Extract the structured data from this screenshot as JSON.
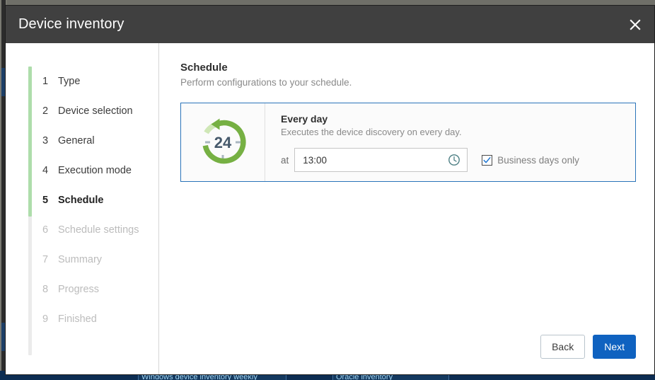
{
  "window": {
    "title": "Device inventory",
    "close_icon": "close-icon"
  },
  "sidebar": {
    "steps": [
      {
        "number": "1",
        "label": "Type",
        "state": "done"
      },
      {
        "number": "2",
        "label": "Device selection",
        "state": "done"
      },
      {
        "number": "3",
        "label": "General",
        "state": "done"
      },
      {
        "number": "4",
        "label": "Execution mode",
        "state": "done"
      },
      {
        "number": "5",
        "label": "Schedule",
        "state": "current"
      },
      {
        "number": "6",
        "label": "Schedule settings",
        "state": "future"
      },
      {
        "number": "7",
        "label": "Summary",
        "state": "future"
      },
      {
        "number": "8",
        "label": "Progress",
        "state": "future"
      },
      {
        "number": "9",
        "label": "Finished",
        "state": "future"
      }
    ]
  },
  "main": {
    "title": "Schedule",
    "subtitle": "Perform configurations to your schedule.",
    "card": {
      "icon_label": "24",
      "icon_name": "every-day-recurrence-icon",
      "title": "Every day",
      "description": "Executes the device discovery on every day.",
      "at_label": "at",
      "time_value": "13:00",
      "time_placeholder": "hh:mm",
      "clock_icon": "clock-icon",
      "checkbox_label": "Business days only",
      "checkbox_checked": "true"
    }
  },
  "footer": {
    "back_label": "Back",
    "next_label": "Next"
  },
  "background": {
    "taskbar_items": [
      "Windows device inventory weekly",
      "Oracle inventory"
    ]
  },
  "colors": {
    "titlebar": "#404040",
    "accent_blue": "#0f62c0",
    "card_border": "#2a74b9",
    "progress_green": "#aeddab",
    "icon_green": "#76b043",
    "icon_text": "#46596b",
    "clock_icon": "#4d7f84",
    "check_blue": "#1f76d2"
  }
}
